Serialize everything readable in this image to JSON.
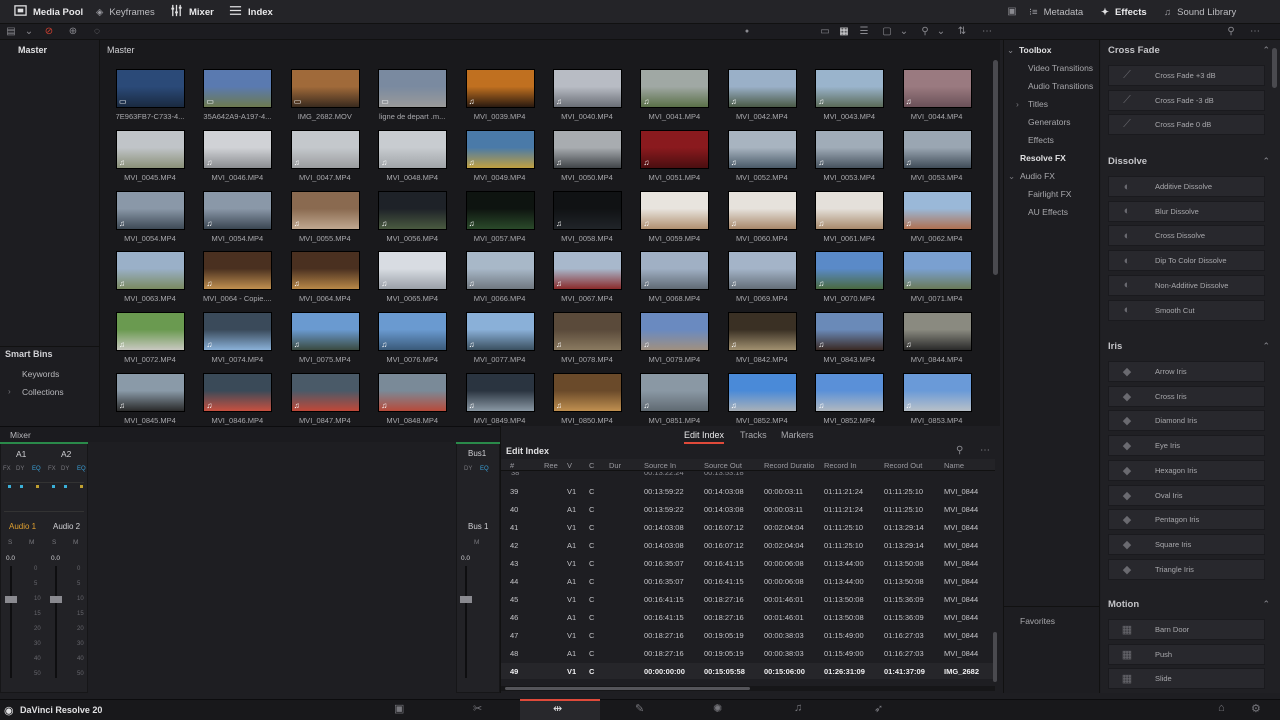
{
  "topbar": {
    "media_pool": "Media Pool",
    "keyframes": "Keyframes",
    "mixer": "Mixer",
    "index": "Index",
    "metadata": "Metadata",
    "effects": "Effects",
    "sound_library": "Sound Library"
  },
  "bins": {
    "master": "Master",
    "pool_title": "Master",
    "smart_bins": "Smart Bins",
    "keywords": "Keywords",
    "collections": "Collections"
  },
  "clips": [
    {
      "name": "7E963FB7-C733-4...",
      "c": [
        "#2b4a78",
        "#1a2a40"
      ],
      "audio": false
    },
    {
      "name": "35A642A9-A197-4...",
      "c": [
        "#5a7ab0",
        "#6d7a50"
      ],
      "audio": false
    },
    {
      "name": "IMG_2682.MOV",
      "c": [
        "#a06a3a",
        "#3a2a1e"
      ],
      "audio": false
    },
    {
      "name": "ligne de depart .m...",
      "c": [
        "#7a8aa0",
        "#9a9a9a"
      ],
      "audio": false
    },
    {
      "name": "MVI_0039.MP4",
      "c": [
        "#c07020",
        "#2a1a10"
      ],
      "audio": true
    },
    {
      "name": "MVI_0040.MP4",
      "c": [
        "#b8bcc4",
        "#6a6e76"
      ],
      "audio": true
    },
    {
      "name": "MVI_0041.MP4",
      "c": [
        "#a0a8a4",
        "#5a7048"
      ],
      "audio": true
    },
    {
      "name": "MVI_0042.MP4",
      "c": [
        "#9ab0c8",
        "#4a5a46"
      ],
      "audio": true
    },
    {
      "name": "MVI_0043.MP4",
      "c": [
        "#9ab4cc",
        "#5a6a58"
      ],
      "audio": true
    },
    {
      "name": "MVI_0044.MP4",
      "c": [
        "#9a7a80",
        "#6a5058"
      ],
      "audio": true
    },
    {
      "name": "MVI_0045.MP4",
      "c": [
        "#c0c4c8",
        "#8a9078"
      ],
      "audio": true
    },
    {
      "name": "MVI_0046.MP4",
      "c": [
        "#d0d2d6",
        "#8a8c90"
      ],
      "audio": true
    },
    {
      "name": "MVI_0047.MP4",
      "c": [
        "#c4c8cc",
        "#9a9c9e"
      ],
      "audio": true
    },
    {
      "name": "MVI_0048.MP4",
      "c": [
        "#c8ccd0",
        "#a0a4a8"
      ],
      "audio": true
    },
    {
      "name": "MVI_0049.MP4",
      "c": [
        "#4a7aa8",
        "#c0a040"
      ],
      "audio": true
    },
    {
      "name": "MVI_0050.MP4",
      "c": [
        "#a8acb0",
        "#404448"
      ],
      "audio": true
    },
    {
      "name": "MVI_0051.MP4",
      "c": [
        "#8a1a1e",
        "#4a0e10"
      ],
      "audio": true
    },
    {
      "name": "MVI_0052.MP4",
      "c": [
        "#a8b4c0",
        "#4a5a68"
      ],
      "audio": true
    },
    {
      "name": "MVI_0053.MP4",
      "c": [
        "#a0acb8",
        "#46525e"
      ],
      "audio": true
    },
    {
      "name": "MVI_0053.MP4",
      "c": [
        "#9aa6b2",
        "#404c58"
      ],
      "audio": true
    },
    {
      "name": "MVI_0054.MP4",
      "c": [
        "#8a98a8",
        "#3e4a56"
      ],
      "audio": true
    },
    {
      "name": "MVI_0054.MP4",
      "c": [
        "#8a98a8",
        "#3a4652"
      ],
      "audio": true
    },
    {
      "name": "MVI_0055.MP4",
      "c": [
        "#8a6a50",
        "#c0a890"
      ],
      "audio": true
    },
    {
      "name": "MVI_0056.MP4",
      "c": [
        "#1e2228",
        "#4a5a40"
      ],
      "audio": true
    },
    {
      "name": "MVI_0057.MP4",
      "c": [
        "#0e1410",
        "#2a4a2a"
      ],
      "audio": true
    },
    {
      "name": "MVI_0058.MP4",
      "c": [
        "#101214",
        "#202428"
      ],
      "audio": true
    },
    {
      "name": "MVI_0059.MP4",
      "c": [
        "#e8e4de",
        "#b09070"
      ],
      "audio": true
    },
    {
      "name": "MVI_0060.MP4",
      "c": [
        "#e6e2dc",
        "#a8886a"
      ],
      "audio": true
    },
    {
      "name": "MVI_0061.MP4",
      "c": [
        "#e4e0da",
        "#a88a6c"
      ],
      "audio": true
    },
    {
      "name": "MVI_0062.MP4",
      "c": [
        "#9ab8d8",
        "#b07050"
      ],
      "audio": true
    },
    {
      "name": "MVI_0063.MP4",
      "c": [
        "#9ab0c8",
        "#7a8a60"
      ],
      "audio": true
    },
    {
      "name": "MVI_0064 - Copie....",
      "c": [
        "#4a3020",
        "#c09050"
      ],
      "audio": true
    },
    {
      "name": "MVI_0064.MP4",
      "c": [
        "#4a3020",
        "#b88848"
      ],
      "audio": true
    },
    {
      "name": "MVI_0065.MP4",
      "c": [
        "#d8dce2",
        "#9aa0a8"
      ],
      "audio": true
    },
    {
      "name": "MVI_0066.MP4",
      "c": [
        "#a8b8c8",
        "#707880"
      ],
      "audio": true
    },
    {
      "name": "MVI_0067.MP4",
      "c": [
        "#a8b8cc",
        "#8a2a2a"
      ],
      "audio": true
    },
    {
      "name": "MVI_0068.MP4",
      "c": [
        "#a0b0c4",
        "#606a74"
      ],
      "audio": true
    },
    {
      "name": "MVI_0069.MP4",
      "c": [
        "#a4b4c8",
        "#646e78"
      ],
      "audio": true
    },
    {
      "name": "MVI_0070.MP4",
      "c": [
        "#5a8ac8",
        "#4a6a40"
      ],
      "audio": true
    },
    {
      "name": "MVI_0071.MP4",
      "c": [
        "#7aa0d0",
        "#6a7a58"
      ],
      "audio": true
    },
    {
      "name": "MVI_0072.MP4",
      "c": [
        "#6a9a50",
        "#c8c8c0"
      ],
      "audio": true
    },
    {
      "name": "MVI_0074.MP4",
      "c": [
        "#3a4a5a",
        "#8ab0d8"
      ],
      "audio": true
    },
    {
      "name": "MVI_0075.MP4",
      "c": [
        "#6a9ad0",
        "#3a4a40"
      ],
      "audio": true
    },
    {
      "name": "MVI_0076.MP4",
      "c": [
        "#6a9ad0",
        "#3a5a7a"
      ],
      "audio": true
    },
    {
      "name": "MVI_0077.MP4",
      "c": [
        "#8ab0d8",
        "#3a5060"
      ],
      "audio": true
    },
    {
      "name": "MVI_0078.MP4",
      "c": [
        "#5a4a3a",
        "#8a7a60"
      ],
      "audio": true
    },
    {
      "name": "MVI_0079.MP4",
      "c": [
        "#6a8ac0",
        "#a09080"
      ],
      "audio": true
    },
    {
      "name": "MVI_0842.MP4",
      "c": [
        "#3a3024",
        "#a09070"
      ],
      "audio": true
    },
    {
      "name": "MVI_0843.MP4",
      "c": [
        "#6a8ab8",
        "#3a2a24"
      ],
      "audio": true
    },
    {
      "name": "MVI_0844.MP4",
      "c": [
        "#8a8a80",
        "#2a2a2a"
      ],
      "audio": true
    },
    {
      "name": "MVI_0845.MP4",
      "c": [
        "#8a9aa8",
        "#2a2a2a"
      ],
      "audio": true
    },
    {
      "name": "MVI_0846.MP4",
      "c": [
        "#3a4a58",
        "#c85040"
      ],
      "audio": true
    },
    {
      "name": "MVI_0847.MP4",
      "c": [
        "#4a5a68",
        "#c04838"
      ],
      "audio": true
    },
    {
      "name": "MVI_0848.MP4",
      "c": [
        "#7a8a98",
        "#b84a3a"
      ],
      "audio": true
    },
    {
      "name": "MVI_0849.MP4",
      "c": [
        "#2a3440",
        "#8a98a4"
      ],
      "audio": true
    },
    {
      "name": "MVI_0850.MP4",
      "c": [
        "#6a4a2a",
        "#c09050"
      ],
      "audio": true
    },
    {
      "name": "MVI_0851.MP4",
      "c": [
        "#8a98a4",
        "#606a72"
      ],
      "audio": true
    },
    {
      "name": "MVI_0852.MP4",
      "c": [
        "#4a8ad8",
        "#a8b0b8"
      ],
      "audio": true
    },
    {
      "name": "MVI_0852.MP4",
      "c": [
        "#5a90d8",
        "#b0b8c0"
      ],
      "audio": true
    },
    {
      "name": "MVI_0853.MP4",
      "c": [
        "#6a9ad8",
        "#b8c0c8"
      ],
      "audio": true
    }
  ],
  "toolbox": {
    "title": "Toolbox",
    "items": [
      "Video Transitions",
      "Audio Transitions",
      "Titles",
      "Generators",
      "Effects",
      "Resolve FX",
      "Audio FX",
      "Fairlight FX",
      "AU Effects"
    ],
    "favorites": "Favorites"
  },
  "fx": {
    "sections": [
      {
        "title": "Cross Fade",
        "items": [
          "Cross Fade +3 dB",
          "Cross Fade -3 dB",
          "Cross Fade 0 dB"
        ]
      },
      {
        "title": "Dissolve",
        "items": [
          "Additive Dissolve",
          "Blur Dissolve",
          "Cross Dissolve",
          "Dip To Color Dissolve",
          "Non-Additive Dissolve",
          "Smooth Cut"
        ]
      },
      {
        "title": "Iris",
        "items": [
          "Arrow Iris",
          "Cross Iris",
          "Diamond Iris",
          "Eye Iris",
          "Hexagon Iris",
          "Oval Iris",
          "Pentagon Iris",
          "Square Iris",
          "Triangle Iris"
        ]
      },
      {
        "title": "Motion",
        "items": [
          "Barn Door",
          "Push",
          "Slide"
        ]
      }
    ]
  },
  "mixer": {
    "title": "Mixer",
    "a1": "A1",
    "a2": "A2",
    "bus1": "Bus1",
    "audio1": "Audio 1",
    "audio2": "Audio 2",
    "bus1_label": "Bus 1",
    "fx": "FX",
    "dy": "DY",
    "eq": "EQ",
    "s": "S",
    "m": "M",
    "val0": "0.0",
    "val1": "0.0",
    "val2": "0.0",
    "scale": [
      "0",
      "5",
      "10",
      "15",
      "20",
      "30",
      "40",
      "50"
    ]
  },
  "edit_index": {
    "tabs": [
      "Edit Index",
      "Tracks",
      "Markers"
    ],
    "title": "Edit Index",
    "columns": [
      "#",
      "Ree",
      "V",
      "C",
      "Dur",
      "Source In",
      "Source Out",
      "Record Duratio",
      "Record In",
      "Record Out",
      "Name"
    ],
    "rows": [
      [
        "39",
        "",
        "V1",
        "C",
        "",
        "00:13:59:22",
        "00:14:03:08",
        "00:00:03:11",
        "01:11:21:24",
        "01:11:25:10",
        "MVI_0844"
      ],
      [
        "40",
        "",
        "A1",
        "C",
        "",
        "00:13:59:22",
        "00:14:03:08",
        "00:00:03:11",
        "01:11:21:24",
        "01:11:25:10",
        "MVI_0844"
      ],
      [
        "41",
        "",
        "V1",
        "C",
        "",
        "00:14:03:08",
        "00:16:07:12",
        "00:02:04:04",
        "01:11:25:10",
        "01:13:29:14",
        "MVI_0844"
      ],
      [
        "42",
        "",
        "A1",
        "C",
        "",
        "00:14:03:08",
        "00:16:07:12",
        "00:02:04:04",
        "01:11:25:10",
        "01:13:29:14",
        "MVI_0844"
      ],
      [
        "43",
        "",
        "V1",
        "C",
        "",
        "00:16:35:07",
        "00:16:41:15",
        "00:00:06:08",
        "01:13:44:00",
        "01:13:50:08",
        "MVI_0844"
      ],
      [
        "44",
        "",
        "A1",
        "C",
        "",
        "00:16:35:07",
        "00:16:41:15",
        "00:00:06:08",
        "01:13:44:00",
        "01:13:50:08",
        "MVI_0844"
      ],
      [
        "45",
        "",
        "V1",
        "C",
        "",
        "00:16:41:15",
        "00:18:27:16",
        "00:01:46:01",
        "01:13:50:08",
        "01:15:36:09",
        "MVI_0844"
      ],
      [
        "46",
        "",
        "A1",
        "C",
        "",
        "00:16:41:15",
        "00:18:27:16",
        "00:01:46:01",
        "01:13:50:08",
        "01:15:36:09",
        "MVI_0844"
      ],
      [
        "47",
        "",
        "V1",
        "C",
        "",
        "00:18:27:16",
        "00:19:05:19",
        "00:00:38:03",
        "01:15:49:00",
        "01:16:27:03",
        "MVI_0844"
      ],
      [
        "48",
        "",
        "A1",
        "C",
        "",
        "00:18:27:16",
        "00:19:05:19",
        "00:00:38:03",
        "01:15:49:00",
        "01:16:27:03",
        "MVI_0844"
      ],
      [
        "49",
        "",
        "V1",
        "C",
        "",
        "00:00:00:00",
        "00:15:05:58",
        "00:15:06:00",
        "01:26:31:09",
        "01:41:37:09",
        "IMG_2682"
      ]
    ]
  },
  "status": {
    "app": "DaVinci Resolve 20"
  },
  "colors": {
    "accent": "#e04a3a",
    "active": "#e8e8ea",
    "panel": "#1e1e22"
  }
}
